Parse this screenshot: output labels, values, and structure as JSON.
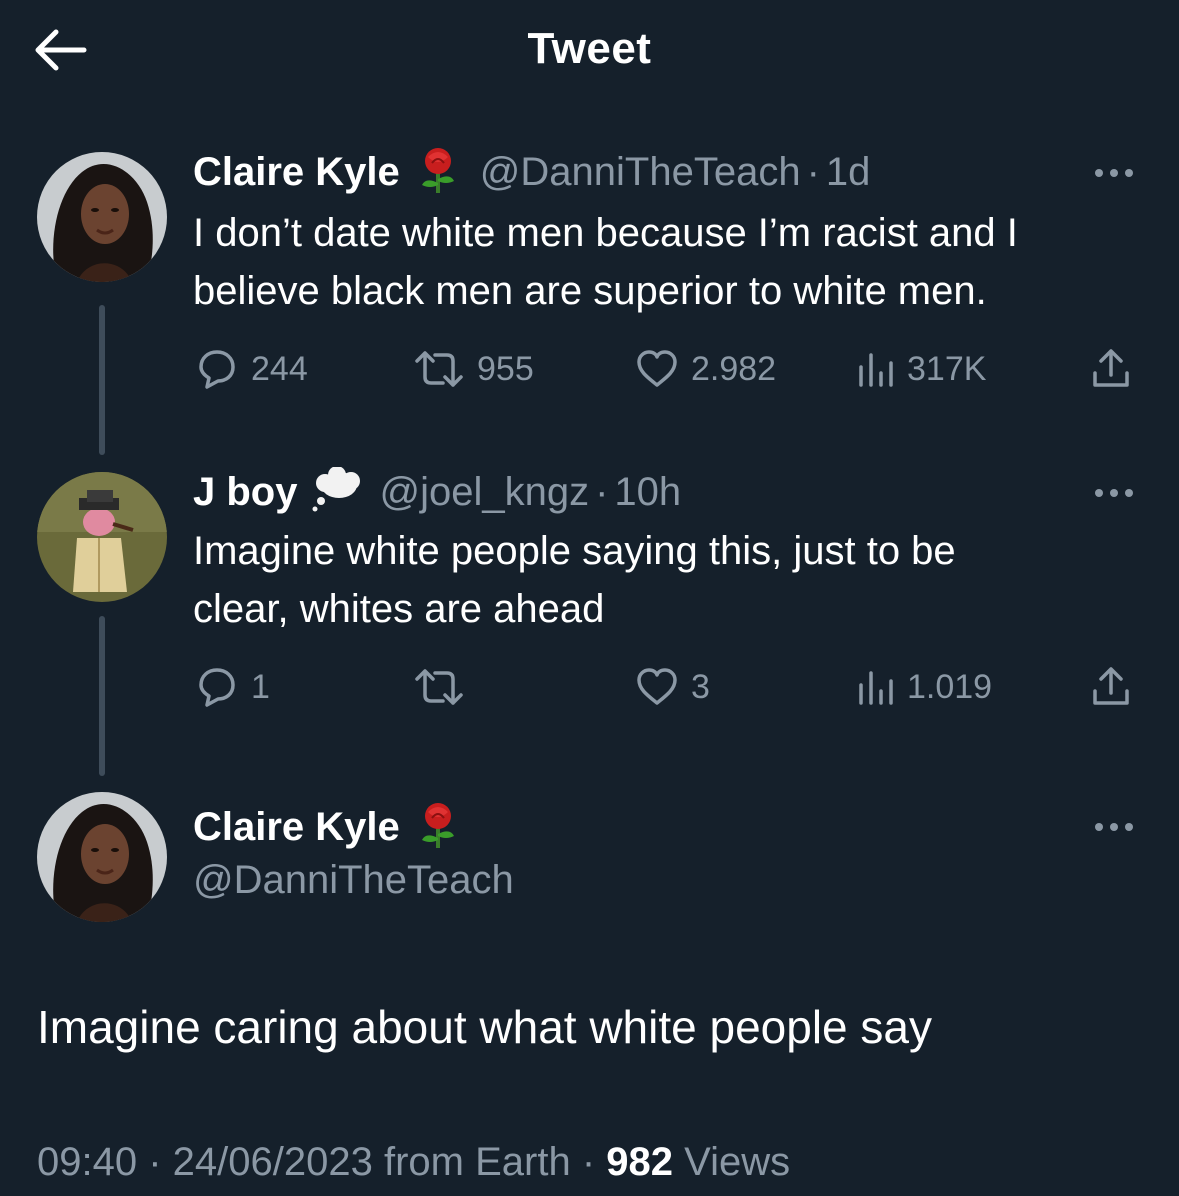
{
  "header": {
    "title": "Tweet",
    "back_icon": "arrow-left-icon"
  },
  "thread": [
    {
      "name": "Claire Kyle",
      "badge_emoji": "rose",
      "handle": "@DanniTheTeach",
      "separator": "·",
      "time": "1d",
      "text_line1": "I don’t date white men because I’m racist and I",
      "text_line2": "believe black men are  superior to white men.",
      "replies": "244",
      "retweets": "955",
      "likes": "2.982",
      "views": "317K"
    },
    {
      "name": "J boy",
      "badge_emoji": "thought-balloon",
      "handle": "@joel_kngz",
      "separator": "·",
      "time": "10h",
      "text_line1": "Imagine white people saying this, just to be",
      "text_line2": "clear,  whites are ahead",
      "replies": "1",
      "retweets": "",
      "likes": "3",
      "views": "1.019"
    }
  ],
  "main_tweet": {
    "name": "Claire Kyle",
    "badge_emoji": "rose",
    "handle": "@DanniTheTeach",
    "text": "Imagine caring about what white people say",
    "time": "09:40",
    "sep1": " · ",
    "date": "24/06/2023",
    "source": " from Earth",
    "sep2": " · ",
    "views_count": "982",
    "views_label": " Views"
  },
  "colors": {
    "background": "#15202b",
    "secondary_text": "#8b98a5",
    "thread_line": "#3e4c5a"
  }
}
